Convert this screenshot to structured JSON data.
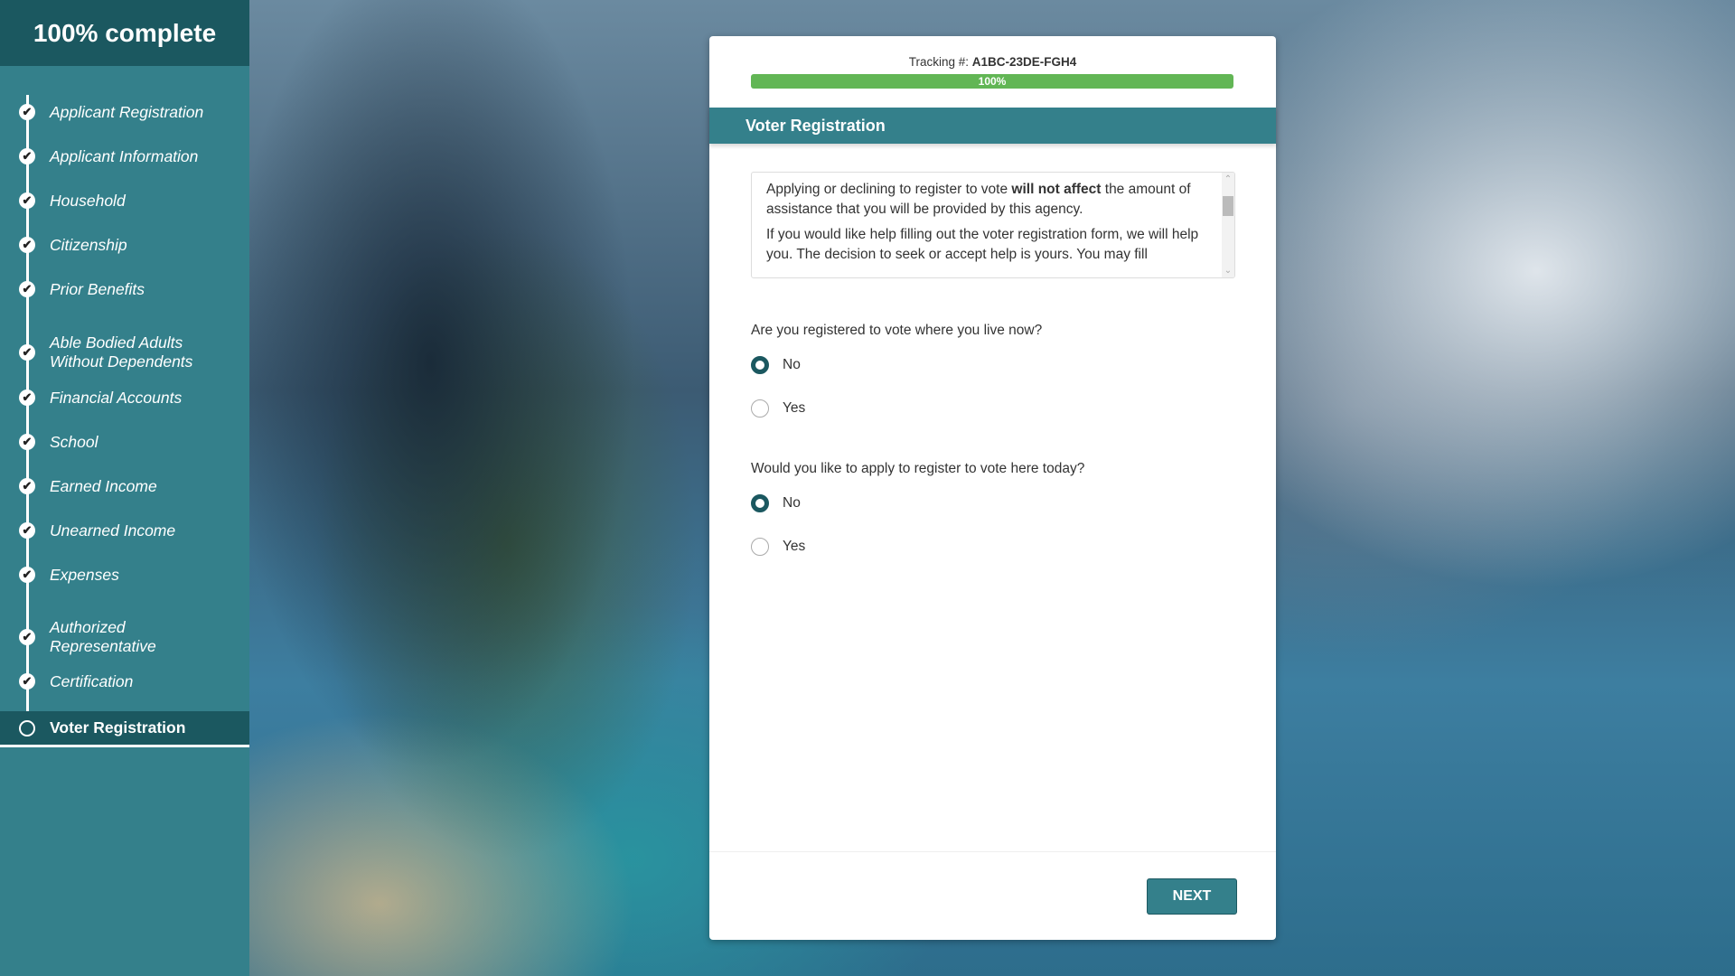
{
  "sidebar": {
    "progress_title": "100% complete",
    "items": [
      {
        "label": "Applicant Registration",
        "status": "complete"
      },
      {
        "label": "Applicant Information",
        "status": "complete"
      },
      {
        "label": "Household",
        "status": "complete"
      },
      {
        "label": "Citizenship",
        "status": "complete"
      },
      {
        "label": "Prior Benefits",
        "status": "complete"
      },
      {
        "label": "Able Bodied Adults Without Dependents",
        "status": "complete"
      },
      {
        "label": "Financial Accounts",
        "status": "complete"
      },
      {
        "label": "School",
        "status": "complete"
      },
      {
        "label": "Earned Income",
        "status": "complete"
      },
      {
        "label": "Unearned Income",
        "status": "complete"
      },
      {
        "label": "Expenses",
        "status": "complete"
      },
      {
        "label": "Authorized Representative",
        "status": "complete"
      },
      {
        "label": "Certification",
        "status": "complete"
      },
      {
        "label": "Voter Registration",
        "status": "current"
      }
    ]
  },
  "card": {
    "tracking_label": "Tracking #:",
    "tracking_number": "A1BC-23DE-FGH4",
    "progress_percent": 100,
    "progress_text": "100%",
    "section_title": "Voter Registration",
    "info": {
      "p1_before": "Applying or declining to register to vote ",
      "p1_bold": "will not affect",
      "p1_after": " the amount of assistance that you will be provided by this agency.",
      "p2": "If you would like help filling out the voter registration form, we will help you. The decision to seek or accept help is yours. You may fill"
    },
    "questions": [
      {
        "text": "Are you registered to vote where you live now?",
        "options": [
          "No",
          "Yes"
        ],
        "selected": "No"
      },
      {
        "text": "Would you like to apply to register to vote here today?",
        "options": [
          "No",
          "Yes"
        ],
        "selected": "No"
      }
    ],
    "next_label": "NEXT"
  },
  "colors": {
    "teal": "#34808b",
    "dark_teal": "#1b5860",
    "progress_green": "#62b655"
  }
}
